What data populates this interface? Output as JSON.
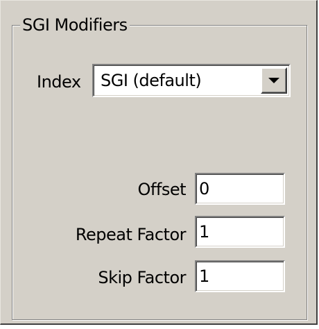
{
  "group": {
    "title": "SGI Modifiers"
  },
  "index": {
    "label": "Index",
    "selected": "SGI (default)"
  },
  "fields": {
    "offset_label": "Offset",
    "offset_value": "0",
    "repeat_label": "Repeat Factor",
    "repeat_value": "1",
    "skip_label": "Skip Factor",
    "skip_value": "1"
  },
  "icons": {
    "dropdown": "chevron-down-icon"
  },
  "colors": {
    "panel_bg": "#d4d0c8",
    "field_bg": "#ffffff",
    "text": "#000000"
  }
}
